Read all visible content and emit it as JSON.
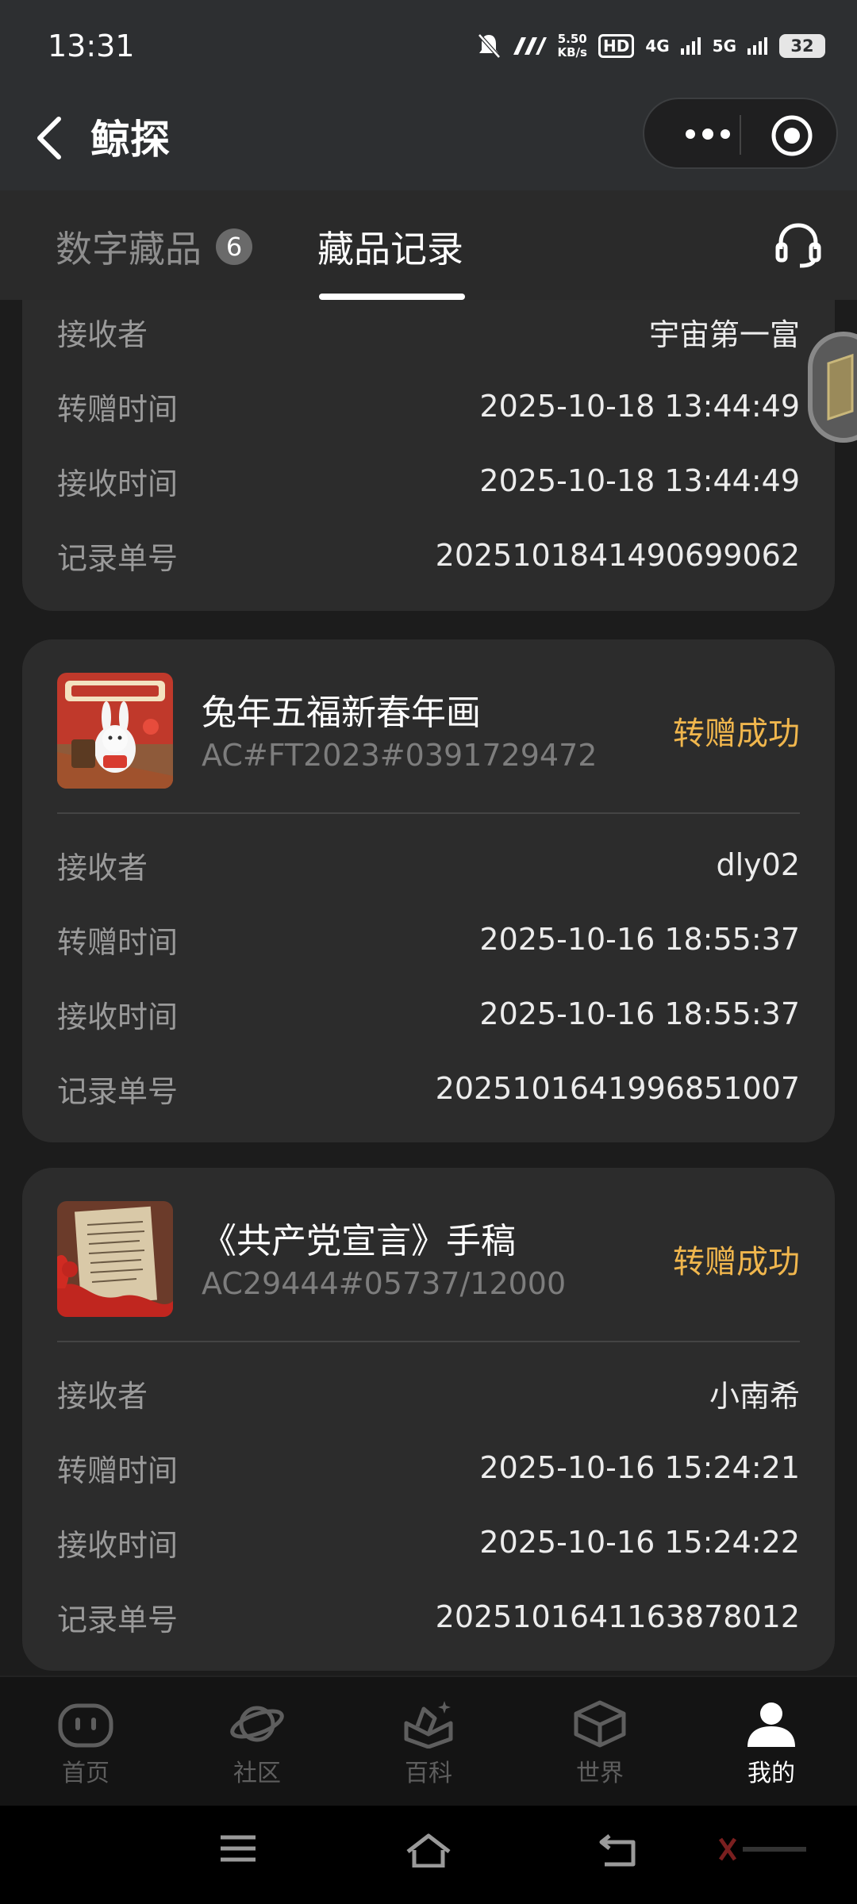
{
  "status_bar": {
    "time": "13:31",
    "speed_value": "5.50",
    "speed_unit": "KB/s",
    "hd_label": "HD",
    "network_4g": "4G",
    "network_5g": "5G",
    "battery": "32"
  },
  "nav": {
    "title": "鲸探"
  },
  "tabs": {
    "tab1_label": "数字藏品",
    "tab1_badge": "6",
    "tab2_label": "藏品记录"
  },
  "records": [
    {
      "rows": [
        {
          "key": "接收者",
          "value": "宇宙第一富"
        },
        {
          "key": "转赠时间",
          "value": "2025-10-18 13:44:49"
        },
        {
          "key": "接收时间",
          "value": "2025-10-18 13:44:49"
        },
        {
          "key": "记录单号",
          "value": "2025101841490699062"
        }
      ]
    },
    {
      "name": "兔年五福新春年画",
      "code": "AC#FT2023#0391729472",
      "status": "转赠成功",
      "rows": [
        {
          "key": "接收者",
          "value": "dly02"
        },
        {
          "key": "转赠时间",
          "value": "2025-10-16 18:55:37"
        },
        {
          "key": "接收时间",
          "value": "2025-10-16 18:55:37"
        },
        {
          "key": "记录单号",
          "value": "2025101641996851007"
        }
      ]
    },
    {
      "name": "《共产党宣言》手稿",
      "code": "AC29444#05737/12000",
      "status": "转赠成功",
      "rows": [
        {
          "key": "接收者",
          "value": "小南希"
        },
        {
          "key": "转赠时间",
          "value": "2025-10-16 15:24:21"
        },
        {
          "key": "接收时间",
          "value": "2025-10-16 15:24:22"
        },
        {
          "key": "记录单号",
          "value": "2025101641163878012"
        }
      ]
    }
  ],
  "bottom_tabs": [
    {
      "label": "首页",
      "icon": "home-face-icon"
    },
    {
      "label": "社区",
      "icon": "planet-icon"
    },
    {
      "label": "百科",
      "icon": "book-sparkle-icon"
    },
    {
      "label": "世界",
      "icon": "cube-icon"
    },
    {
      "label": "我的",
      "icon": "person-icon",
      "active": true
    }
  ],
  "colors": {
    "accent_status": "#f0b64d",
    "background": "#1c1c1c",
    "card": "#2c2c2c"
  }
}
